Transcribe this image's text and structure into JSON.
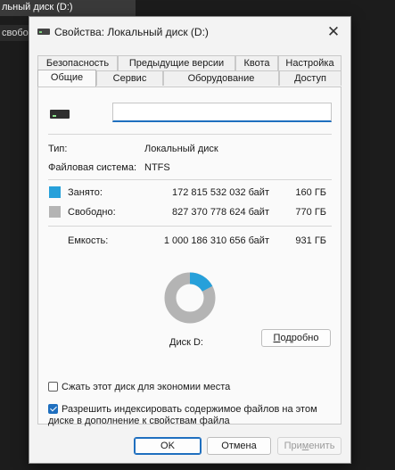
{
  "background": {
    "window_title_fragment": "льный диск (D:)",
    "side_fragment": "свобо"
  },
  "dialog": {
    "title": "Свойства: Локальный диск (D:)",
    "close_glyph": "✕"
  },
  "tabs_row1": [
    "Безопасность",
    "Предыдущие версии",
    "Квота",
    "Настройка"
  ],
  "tabs_row2": [
    "Общие",
    "Сервис",
    "Оборудование",
    "Доступ"
  ],
  "active_tab": "Общие",
  "general": {
    "name_value": "",
    "type_label": "Тип:",
    "type_value": "Локальный диск",
    "fs_label": "Файловая система:",
    "fs_value": "NTFS",
    "used_label": "Занято:",
    "used_bytes": "172 815 532 032 байт",
    "used_gb": "160 ГБ",
    "free_label": "Свободно:",
    "free_bytes": "827 370 778 624 байт",
    "free_gb": "770 ГБ",
    "capacity_label": "Емкость:",
    "capacity_bytes": "1 000 186 310 656 байт",
    "capacity_gb": "931 ГБ",
    "used_fraction": 0.1728,
    "disk_label": "Диск D:",
    "details_prefix": "",
    "details_accel": "П",
    "details_rest": "одробно",
    "compress_label": "Сжать этот диск для экономии места",
    "compress_checked": false,
    "index_label_1": "Разрешить индексировать содержимое файлов на этом",
    "index_label_2": "диске в дополнение к свойствам файла",
    "index_checked": true
  },
  "colors": {
    "used": "#26a0da",
    "free": "#b4b4b4",
    "accent": "#1f6fbf"
  },
  "footer": {
    "ok": "OK",
    "cancel": "Отмена",
    "apply_prefix": "При",
    "apply_accel": "м",
    "apply_rest": "енить"
  }
}
